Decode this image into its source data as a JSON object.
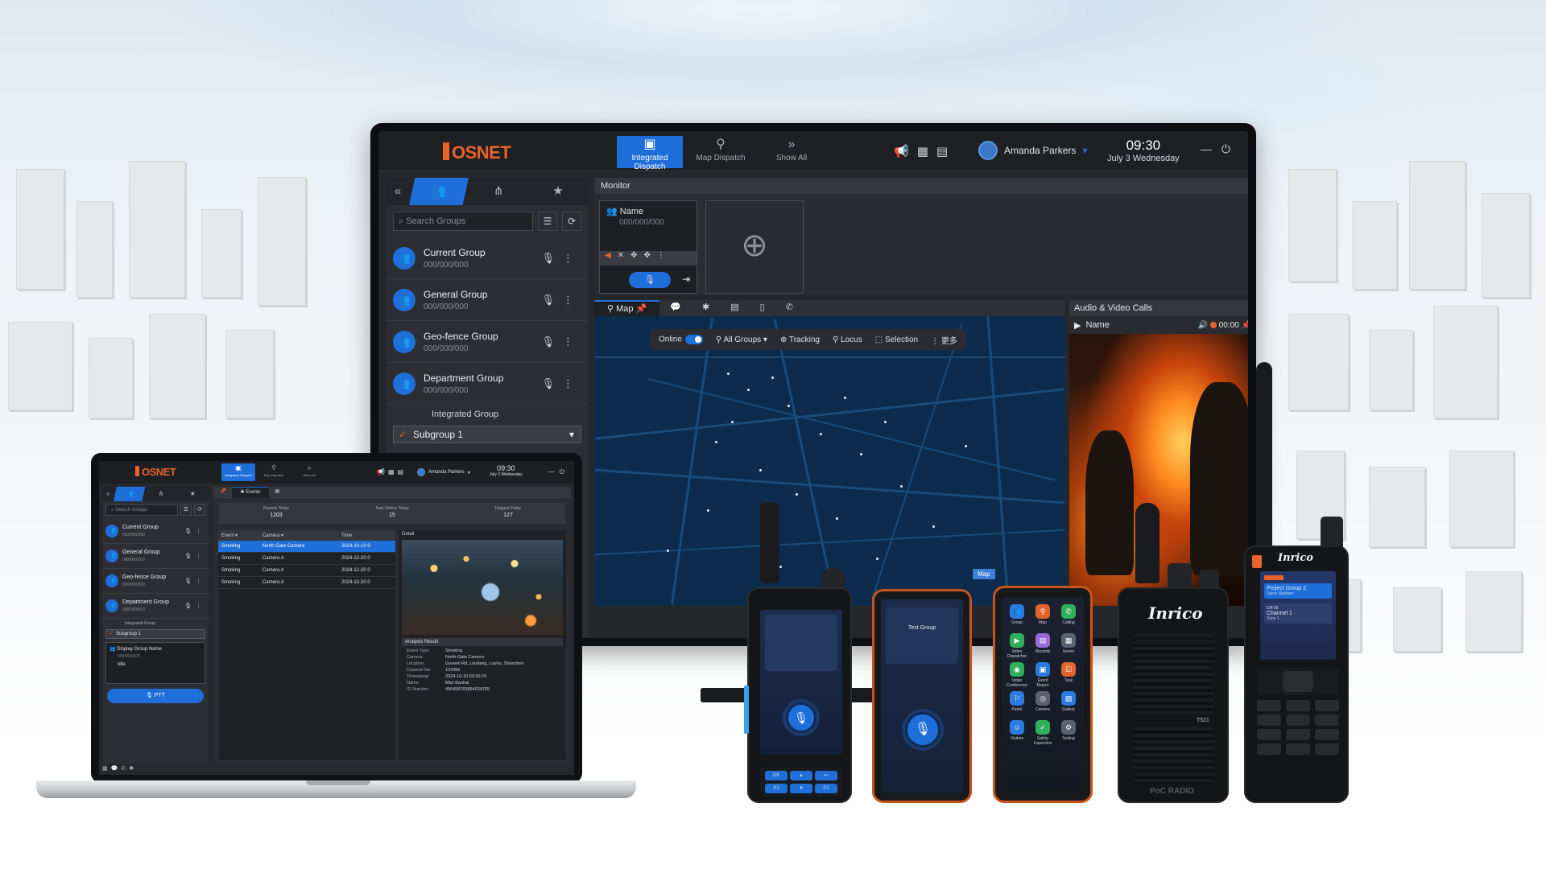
{
  "brand": {
    "logo_text": "OSNET",
    "accent": "#e8632a",
    "primary": "#1e6fd9"
  },
  "desktop": {
    "nav_tabs": [
      {
        "label": "Integrated Dispatch",
        "icon": "monitor-icon",
        "active": true
      },
      {
        "label": "Map Dispatch",
        "icon": "user-pin-icon",
        "active": false
      },
      {
        "label": "Show All",
        "icon": "chevrons-right-icon",
        "active": false
      }
    ],
    "user_name": "Amanda Parkers",
    "time": "09:30",
    "date": "July 3 Wednesday",
    "search_placeholder": "Search Groups",
    "groups": [
      {
        "name": "Current Group",
        "id": "000/000/000"
      },
      {
        "name": "General Group",
        "id": "000/000/000"
      },
      {
        "name": "Geo-fence Group",
        "id": "000/000/000"
      },
      {
        "name": "Department Group",
        "id": "000/000/000"
      }
    ],
    "integrated_group": "Integrated Group",
    "subgroup": "Subgroup 1",
    "monitor_title": "Monitor",
    "monitor_card": {
      "name": "Name",
      "id": "000/000/000"
    },
    "map_tab": "Map",
    "map_toolbar": {
      "online": "Online",
      "all_groups": "All Groups",
      "tracking": "Tracking",
      "locus": "Locus",
      "selection": "Selection",
      "more": "更多"
    },
    "map_label": "Map",
    "av_title": "Audio & Video Calls",
    "av_name": "Name",
    "av_timer": "00:00"
  },
  "laptop": {
    "nav_tabs": [
      {
        "label": "Integrated Dispatch"
      },
      {
        "label": "Map Dispatch"
      },
      {
        "label": "Show All"
      }
    ],
    "user_name": "Amanda Parkers",
    "time": "09:30",
    "date": "July 3 Wednesday",
    "search_placeholder": "Search Groups",
    "groups": [
      {
        "name": "Current Group",
        "id": "000/000/000"
      },
      {
        "name": "General Group",
        "id": "000/000/000"
      },
      {
        "name": "Geo-fence Group",
        "id": "000/000/000"
      },
      {
        "name": "Department Group",
        "id": "000/000/000"
      }
    ],
    "integrated_group": "Integrated Group",
    "subgroup": "Subgroup 1",
    "display_group": "Display Group Name",
    "display_id": "000/000/000",
    "status": "Idle",
    "ptt": "PTT",
    "events_tab": "Events",
    "stats": [
      {
        "label": "Reports Today",
        "value": "1203"
      },
      {
        "label": "Task Orders Today",
        "value": "15"
      },
      {
        "label": "Flagged Today",
        "value": "127"
      }
    ],
    "event_columns": [
      "Event",
      "Camera",
      "Time"
    ],
    "events": [
      {
        "event": "Smoking",
        "camera": "North Gate Camera",
        "time": "2024-10-10 0"
      },
      {
        "event": "Smoking",
        "camera": "Camera A",
        "time": "2024-12-20 0"
      },
      {
        "event": "Smoking",
        "camera": "Camera A",
        "time": "2024-12-20 0"
      },
      {
        "event": "Smoking",
        "camera": "Camera A",
        "time": "2024-12-20 0"
      }
    ],
    "detail_title": "Detail",
    "analysis_title": "Analysis Result",
    "details": [
      {
        "k": "Event Type:",
        "v": "Smoking"
      },
      {
        "k": "Camera:",
        "v": "North Gate Camera"
      },
      {
        "k": "Location:",
        "v": "Guowei Rd, Liantang, Luohu, Shenzhen"
      },
      {
        "k": "Channel No.:",
        "v": "123456"
      },
      {
        "k": "Timestamp:",
        "v": "2024-10-10 09:30:24"
      },
      {
        "k": "Name:",
        "v": "Man Baohai"
      },
      {
        "k": "ID Number:",
        "v": "456458765864634765"
      }
    ]
  },
  "devices": {
    "phone2_group": "Test Group",
    "radio_brand": "Inrico",
    "radio_model": "T521",
    "radio_tag": "PoC RADIO",
    "radio2_group": "Project Group 2",
    "radio2_user": "Jason Statham",
    "radio2_channel": "Channel 1",
    "radio2_zone": "Zone 1",
    "radio2_ch": "CH-09",
    "apps": [
      "Group",
      "Map",
      "Calling",
      "Video Dispatcher",
      "Records",
      "Server",
      "Video Conference",
      "Event Report",
      "Task",
      "Patrol",
      "Camera",
      "Gallery",
      "Visitors",
      "Safety Inspection",
      "Setting"
    ]
  }
}
